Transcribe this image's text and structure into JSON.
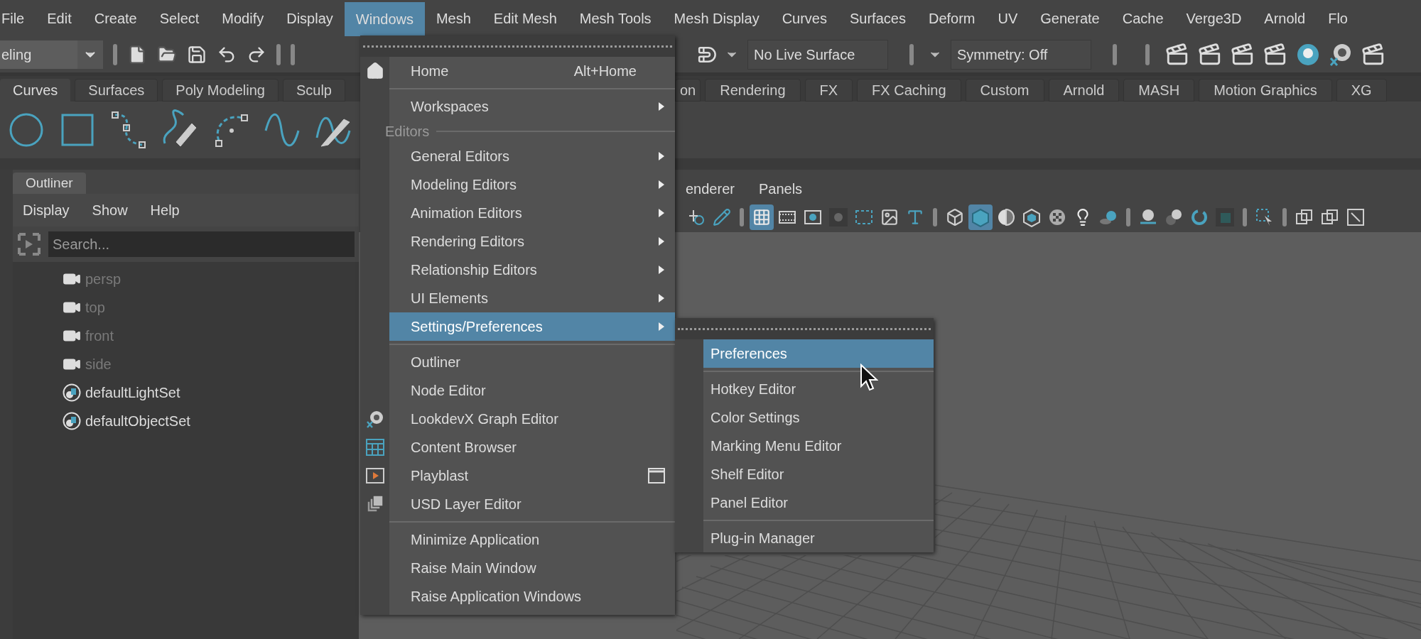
{
  "menu_bar": [
    {
      "label": "File",
      "selected": false
    },
    {
      "label": "Edit",
      "selected": false
    },
    {
      "label": "Create",
      "selected": false
    },
    {
      "label": "Select",
      "selected": false
    },
    {
      "label": "Modify",
      "selected": false
    },
    {
      "label": "Display",
      "selected": false
    },
    {
      "label": "Windows",
      "selected": true
    },
    {
      "label": "Mesh",
      "selected": false
    },
    {
      "label": "Edit Mesh",
      "selected": false
    },
    {
      "label": "Mesh Tools",
      "selected": false
    },
    {
      "label": "Mesh Display",
      "selected": false
    },
    {
      "label": "Curves",
      "selected": false
    },
    {
      "label": "Surfaces",
      "selected": false
    },
    {
      "label": "Deform",
      "selected": false
    },
    {
      "label": "UV",
      "selected": false
    },
    {
      "label": "Generate",
      "selected": false
    },
    {
      "label": "Cache",
      "selected": false
    },
    {
      "label": "Verge3D",
      "selected": false
    },
    {
      "label": "Arnold",
      "selected": false
    },
    {
      "label": "Flo",
      "selected": false
    }
  ],
  "toolbar": {
    "workspace": "eling",
    "live_surface": "No Live Surface",
    "symmetry": "Symmetry: Off"
  },
  "shelf_tabs_left": [
    {
      "label": "Curves",
      "selected": true
    },
    {
      "label": "Surfaces",
      "selected": false
    },
    {
      "label": "Poly Modeling",
      "selected": false
    },
    {
      "label": "Sculp",
      "selected": false
    }
  ],
  "shelf_tabs_right": [
    {
      "label": "on",
      "selected": false
    },
    {
      "label": "Rendering",
      "selected": false
    },
    {
      "label": "FX",
      "selected": false
    },
    {
      "label": "FX Caching",
      "selected": false
    },
    {
      "label": "Custom",
      "selected": false
    },
    {
      "label": "Arnold",
      "selected": false
    },
    {
      "label": "MASH",
      "selected": false
    },
    {
      "label": "Motion Graphics",
      "selected": false
    },
    {
      "label": "XG",
      "selected": false
    }
  ],
  "outliner": {
    "title": "Outliner",
    "menu": [
      "Display",
      "Show",
      "Help"
    ],
    "search_placeholder": "Search...",
    "items": [
      {
        "label": "persp",
        "kind": "camera",
        "hidden": true
      },
      {
        "label": "top",
        "kind": "camera",
        "hidden": true
      },
      {
        "label": "front",
        "kind": "camera",
        "hidden": true
      },
      {
        "label": "side",
        "kind": "camera",
        "hidden": true
      },
      {
        "label": "defaultLightSet",
        "kind": "set",
        "hidden": false
      },
      {
        "label": "defaultObjectSet",
        "kind": "set",
        "hidden": false
      }
    ]
  },
  "viewport": {
    "menu": [
      "enderer",
      "Panels"
    ],
    "tools": [
      {
        "kind": "camera-tool",
        "selected": false
      },
      {
        "kind": "paint",
        "selected": false
      },
      {
        "kind": "sep"
      },
      {
        "kind": "grid",
        "selected": true
      },
      {
        "kind": "film",
        "selected": false
      },
      {
        "kind": "gate",
        "selected": false
      },
      {
        "kind": "dark-gate",
        "selected": false
      },
      {
        "kind": "safe",
        "selected": false
      },
      {
        "kind": "image",
        "selected": false
      },
      {
        "kind": "text",
        "selected": false
      },
      {
        "kind": "sep"
      },
      {
        "kind": "wire-cube",
        "selected": false
      },
      {
        "kind": "shaded-cube",
        "selected": true
      },
      {
        "kind": "half-sphere",
        "selected": false
      },
      {
        "kind": "tex-cube",
        "selected": false
      },
      {
        "kind": "checker",
        "selected": false
      },
      {
        "kind": "light",
        "selected": false
      },
      {
        "kind": "shadow",
        "selected": false
      },
      {
        "kind": "sep"
      },
      {
        "kind": "ground",
        "selected": false
      },
      {
        "kind": "spheres",
        "selected": false
      },
      {
        "kind": "ring",
        "selected": false
      },
      {
        "kind": "dark-square",
        "selected": false
      },
      {
        "kind": "sep"
      },
      {
        "kind": "select",
        "selected": false
      },
      {
        "kind": "sep"
      },
      {
        "kind": "iso",
        "selected": false
      },
      {
        "kind": "iso",
        "selected": false
      },
      {
        "kind": "pick",
        "selected": false
      }
    ]
  },
  "windows_menu": {
    "items": [
      {
        "kind": "item",
        "label": "Home",
        "shortcut": "Alt+Home",
        "submenu": false,
        "selected": false,
        "option_box": false
      },
      {
        "kind": "separator"
      },
      {
        "kind": "item",
        "label": "Workspaces",
        "submenu": true,
        "selected": false,
        "option_box": false
      },
      {
        "kind": "section",
        "label": "Editors"
      },
      {
        "kind": "item",
        "label": "General Editors",
        "submenu": true,
        "selected": false,
        "option_box": false
      },
      {
        "kind": "item",
        "label": "Modeling Editors",
        "submenu": true,
        "selected": false,
        "option_box": false
      },
      {
        "kind": "item",
        "label": "Animation Editors",
        "submenu": true,
        "selected": false,
        "option_box": false
      },
      {
        "kind": "item",
        "label": "Rendering Editors",
        "submenu": true,
        "selected": false,
        "option_box": false
      },
      {
        "kind": "item",
        "label": "Relationship Editors",
        "submenu": true,
        "selected": false,
        "option_box": false
      },
      {
        "kind": "item",
        "label": "UI Elements",
        "submenu": true,
        "selected": false,
        "option_box": false
      },
      {
        "kind": "item",
        "label": "Settings/Preferences",
        "submenu": true,
        "selected": true,
        "option_box": false
      },
      {
        "kind": "separator"
      },
      {
        "kind": "item",
        "label": "Outliner",
        "submenu": false,
        "selected": false,
        "option_box": false
      },
      {
        "kind": "item",
        "label": "Node Editor",
        "submenu": false,
        "selected": false,
        "option_box": false
      },
      {
        "kind": "item",
        "label": "LookdevX Graph Editor",
        "submenu": false,
        "selected": false,
        "option_box": false
      },
      {
        "kind": "item",
        "label": "Content Browser",
        "submenu": false,
        "selected": false,
        "option_box": false
      },
      {
        "kind": "item",
        "label": "Playblast",
        "submenu": false,
        "selected": false,
        "option_box": true
      },
      {
        "kind": "item",
        "label": "USD Layer Editor",
        "submenu": false,
        "selected": false,
        "option_box": false
      },
      {
        "kind": "separator"
      },
      {
        "kind": "item",
        "label": "Minimize Application",
        "submenu": false,
        "selected": false,
        "option_box": false
      },
      {
        "kind": "item",
        "label": "Raise Main Window",
        "submenu": false,
        "selected": false,
        "option_box": false
      },
      {
        "kind": "item",
        "label": "Raise Application Windows",
        "submenu": false,
        "selected": false,
        "option_box": false
      }
    ]
  },
  "settings_submenu": {
    "items": [
      {
        "kind": "item",
        "label": "Preferences",
        "selected": true
      },
      {
        "kind": "separator"
      },
      {
        "kind": "item",
        "label": "Hotkey Editor",
        "selected": false
      },
      {
        "kind": "item",
        "label": "Color Settings",
        "selected": false
      },
      {
        "kind": "item",
        "label": "Marking Menu Editor",
        "selected": false
      },
      {
        "kind": "item",
        "label": "Shelf Editor",
        "selected": false
      },
      {
        "kind": "item",
        "label": "Panel Editor",
        "selected": false
      },
      {
        "kind": "separator"
      },
      {
        "kind": "item",
        "label": "Plug-in Manager",
        "selected": false
      }
    ]
  }
}
